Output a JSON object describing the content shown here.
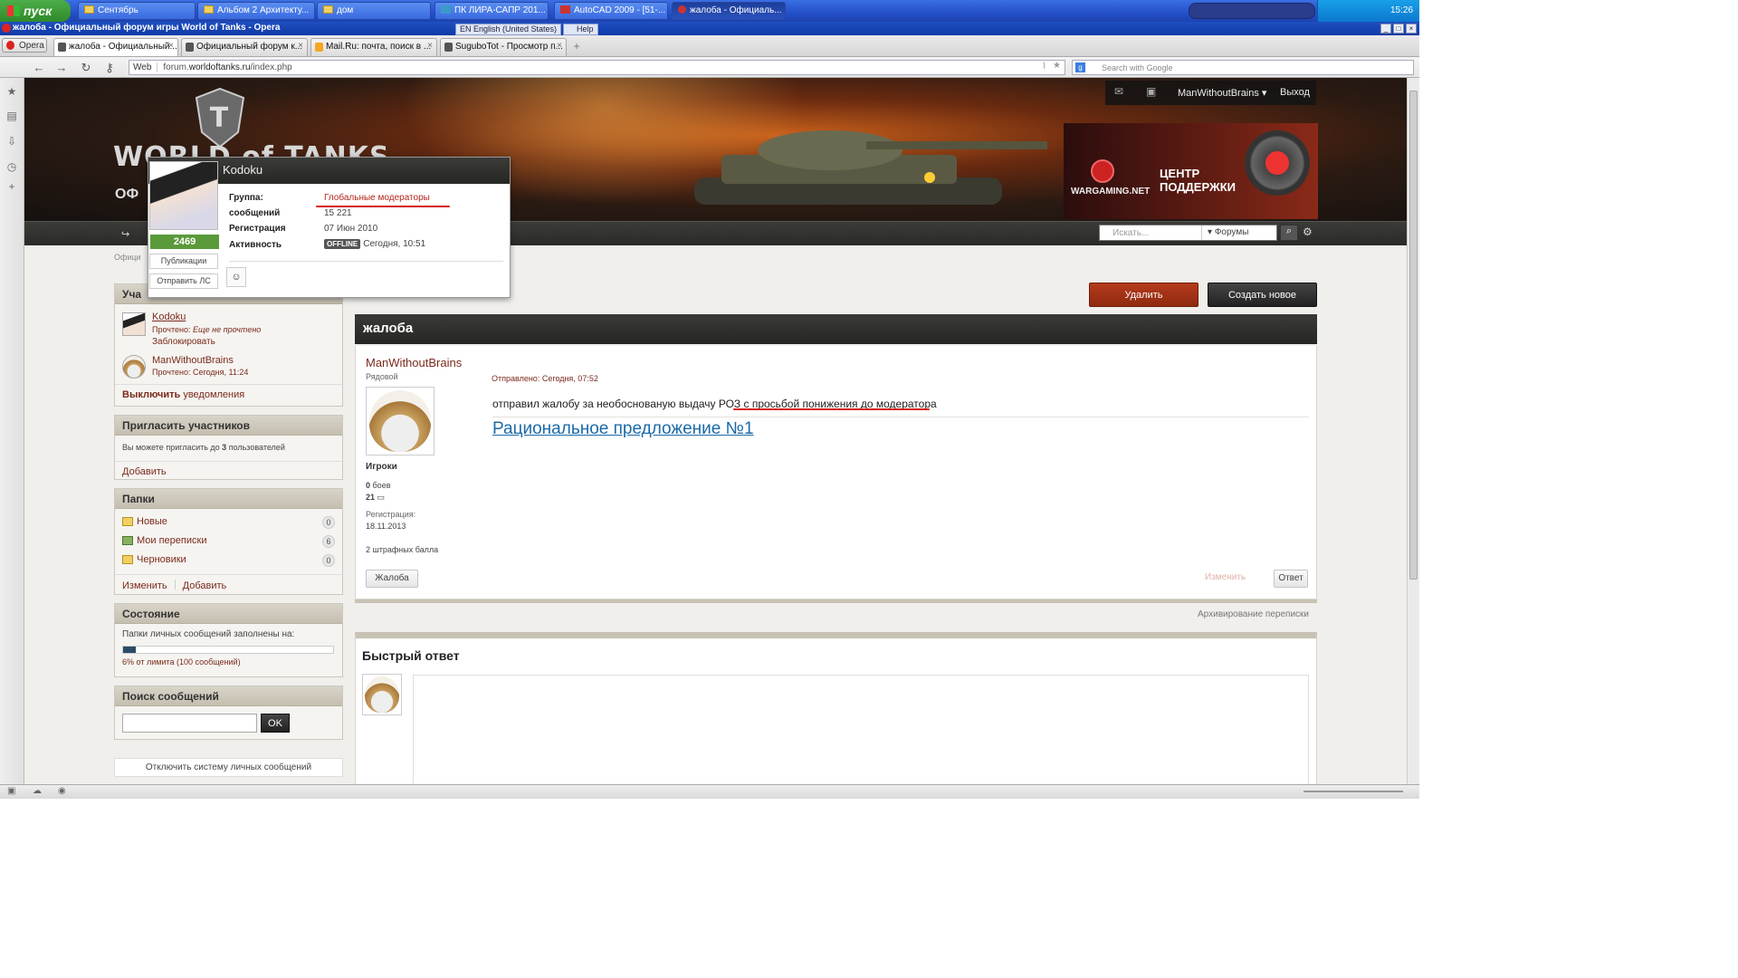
{
  "taskbar": {
    "start_label": "пуск",
    "items": [
      {
        "label": "Сентябрь",
        "icon": "folder-icon"
      },
      {
        "label": "Альбом 2 Архитекту...",
        "icon": "folder-icon"
      },
      {
        "label": "дом",
        "icon": "folder-icon"
      },
      {
        "label": "ПК ЛИРА-САПР  201...",
        "icon": "app-icon"
      },
      {
        "label": "AutoCAD 2009 - [51-...",
        "icon": "app-icon"
      },
      {
        "label": "жалоба - Официаль...",
        "icon": "opera-icon"
      }
    ],
    "clock": "15:26"
  },
  "window": {
    "title": "жалоба - Официальный форум игры World of Tanks - Opera",
    "lang": "EN English (United States)",
    "help": "Help"
  },
  "browser": {
    "opera_label": "Opera",
    "tabs": [
      {
        "label": "жалоба - Официальный..."
      },
      {
        "label": "Официальный форум к..."
      },
      {
        "label": "Mail.Ru: почта, поиск в ..."
      },
      {
        "label": "SugubоTot - Просмотр п..."
      }
    ],
    "web_label": "Web",
    "url_prefix": "forum.",
    "url_domain": "worldoftanks.ru",
    "url_path": "/index.php",
    "search_placeholder": "Search with Google"
  },
  "header": {
    "logo_text": "WORLD of TANKS",
    "subtitle": "ОФ",
    "username": "ManWithoutBrains",
    "logout": "Выход",
    "wg_label": "WARGAMING.NET",
    "support_line1": "ЦЕНТР",
    "support_line2": "ПОДДЕРЖКИ"
  },
  "navbar": {
    "search_placeholder": "Искать...",
    "search_scope": "Форумы"
  },
  "breadcrumb": "Офици",
  "popup": {
    "name": "Kodoku",
    "reputation": "2469",
    "publications": "Публикации",
    "send_pm": "Отправить ЛС",
    "rows": [
      {
        "label": "Группа:",
        "value": "Глобальные модераторы"
      },
      {
        "label": "сообщений",
        "value": "15  221"
      },
      {
        "label": "Регистрация",
        "value": "07 Июн 2010"
      },
      {
        "label": "Активность",
        "value": "Сегодня, 10:51"
      }
    ],
    "offline": "OFFLINE"
  },
  "sidebar": {
    "participants": {
      "title": "Участники",
      "title_visible": "Уча",
      "users": [
        {
          "name": "Kodoku",
          "status_prefix": "Прочтено:",
          "status": "Еще не прочтено",
          "action": "Заблокировать"
        },
        {
          "name": "ManWithoutBrains",
          "status_prefix": "Прочтено:",
          "status": "Сегодня, 11:24"
        }
      ],
      "notify_bold": "Выключить",
      "notify_rest": "уведомления"
    },
    "invite": {
      "title": "Пригласить участников",
      "text_prefix": "Вы можете пригласить до ",
      "text_count": "3",
      "text_suffix": " пользователей",
      "add": "Добавить"
    },
    "folders": {
      "title": "Папки",
      "items": [
        {
          "label": "Новые",
          "count": "0"
        },
        {
          "label": "Мои переписки",
          "count": "6"
        },
        {
          "label": "Черновики",
          "count": "0"
        }
      ],
      "edit": "Изменить",
      "add": "Добавить"
    },
    "status": {
      "title": "Состояние",
      "text": "Папки личных сообщений заполнены на:",
      "fill_percent": 6,
      "limit": "6% от лимита (100 сообщений)"
    },
    "msgsearch": {
      "title": "Поиск сообщений",
      "ok": "OK"
    },
    "disable_pm": "Отключить систему личных сообщений"
  },
  "main": {
    "delete_label": "Удалить",
    "new_label": "Создать новое",
    "topic_title": "жалоба",
    "post": {
      "author": "ManWithoutBrains",
      "rank": "Рядовой",
      "group": "Игроки",
      "battles_count": "0",
      "battles_label": "боев",
      "posts_count": "21",
      "reg_label": "Регистрация:",
      "reg_date": "18.11.2013",
      "penalty": "2 штрафных балла",
      "sent": "Отправлено: Сегодня, 07:52",
      "message": "отправил жалобу за необоснованую выдачу РОЗ с просьбой понижения до модератора",
      "link": "Рациональное предложение №1",
      "complaint_label": "Жалоба",
      "edit_label": "Изменить",
      "reply_label": "Ответ"
    },
    "archive_label": "Архивирование переписки",
    "quick_reply_title": "Быстрый ответ"
  },
  "colors": {
    "accent_red": "#7a2a1c",
    "delete_button": "#a8341a",
    "annotation_red": "#d41a1a",
    "link_blue": "#1b6aa8"
  }
}
